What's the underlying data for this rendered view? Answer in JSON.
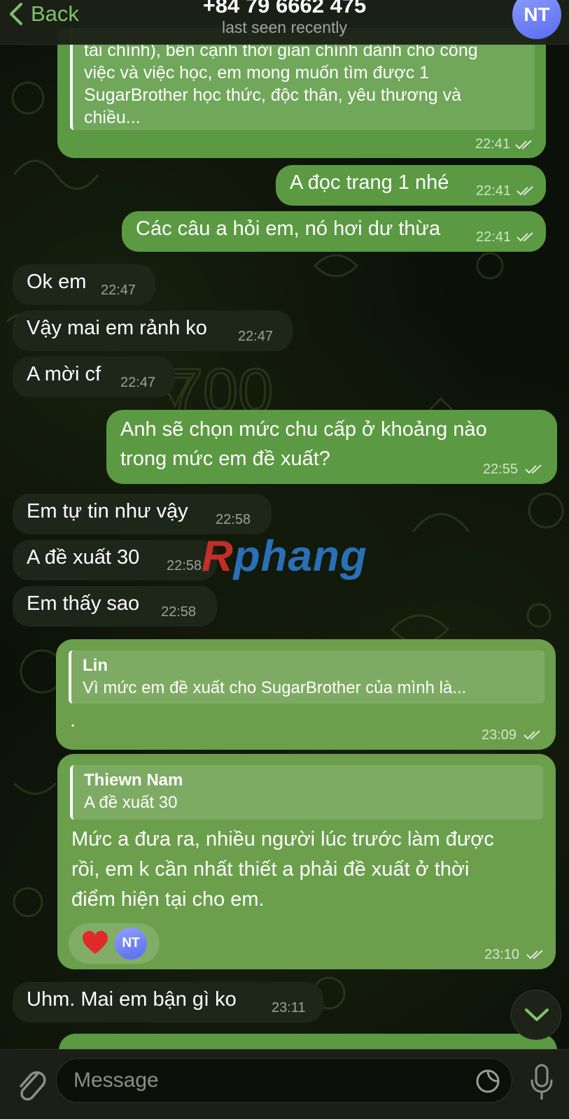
{
  "header": {
    "back_label": "Back",
    "contact_name": "+84 79 6662 475",
    "status": "last seen recently",
    "avatar_initials": "NT"
  },
  "messages": [
    {
      "dir": "out",
      "text_lines": [
        "tài chính), bên cạnh thời gian chính dành cho công",
        "việc và việc học, em mong muốn tìm được 1",
        "SugarBrother học thức, độc thân, yêu thương và",
        "chiều..."
      ],
      "time": "22:41",
      "note": "continued quote"
    },
    {
      "dir": "out",
      "text": "A đọc trang 1 nhé",
      "time": "22:41"
    },
    {
      "dir": "out",
      "text": "Các câu a hỏi em, nó hơi dư thừa",
      "time": "22:41"
    },
    {
      "dir": "in",
      "text": "Ok em",
      "time": "22:47"
    },
    {
      "dir": "in",
      "text": "Vậy mai em rảnh ko",
      "time": "22:47"
    },
    {
      "dir": "in",
      "text": "A mời cf",
      "time": "22:47"
    },
    {
      "dir": "out",
      "text_lines": [
        "Anh sẽ chọn mức chu cấp ở khoảng nào",
        "trong mức em đề xuất?"
      ],
      "time": "22:55"
    },
    {
      "dir": "in",
      "text": "Em tự tin như vậy",
      "time": "22:58"
    },
    {
      "dir": "in",
      "text": "A đề xuất 30",
      "time": "22:58"
    },
    {
      "dir": "in",
      "text": "Em thấy sao",
      "time": "22:58"
    },
    {
      "dir": "out",
      "reply_name": "Lin",
      "reply_text": "Vì mức em đề xuất cho SugarBrother của mình là...",
      "text": ".",
      "time": "23:09"
    },
    {
      "dir": "out",
      "reply_name": "Thiewn Nam",
      "reply_text": "A đề xuất 30",
      "text_lines": [
        "Mức a đưa ra, nhiều người lúc trước làm được",
        "rồi, em k cần nhất thiết a phải đề xuất ở thời",
        "điểm hiện tại cho em."
      ],
      "time": "23:10",
      "reaction_initials": "NT"
    },
    {
      "dir": "in",
      "text": "Uhm. Mai em bận gì ko",
      "time": "23:11"
    }
  ],
  "watermark": {
    "first": "R",
    "rest": "phang"
  },
  "input": {
    "placeholder": "Message"
  },
  "colors": {
    "accent": "#7ec36a",
    "outgoing": "#5b9a42",
    "incoming": "#1e2619",
    "avatar": "#6f7ff5"
  }
}
